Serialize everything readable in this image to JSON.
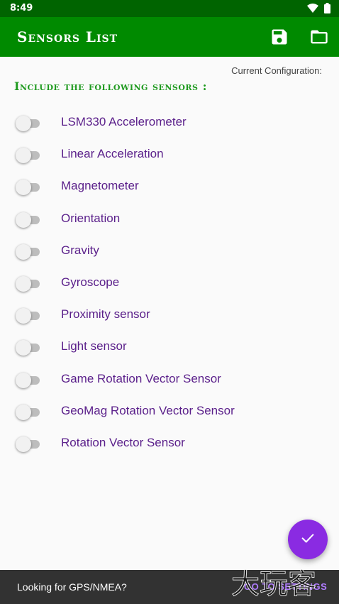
{
  "status_bar": {
    "time": "8:49",
    "icons": [
      "wifi-icon",
      "battery-icon"
    ]
  },
  "app_bar": {
    "title": "Sensors List",
    "actions": [
      "save-icon",
      "folder-icon"
    ]
  },
  "config_label": "Current Configuration:",
  "heading": "Include the following sensors :",
  "sensors": [
    {
      "label": "LSM330 Accelerometer",
      "enabled": false
    },
    {
      "label": "Linear Acceleration",
      "enabled": false
    },
    {
      "label": "Magnetometer",
      "enabled": false
    },
    {
      "label": "Orientation",
      "enabled": false
    },
    {
      "label": "Gravity",
      "enabled": false
    },
    {
      "label": "Gyroscope",
      "enabled": false
    },
    {
      "label": "Proximity sensor",
      "enabled": false
    },
    {
      "label": "Light sensor",
      "enabled": false
    },
    {
      "label": "Game Rotation Vector Sensor",
      "enabled": false
    },
    {
      "label": "GeoMag Rotation Vector Sensor",
      "enabled": false
    },
    {
      "label": "Rotation Vector Sensor",
      "enabled": false
    }
  ],
  "fab": {
    "icon": "check-icon"
  },
  "snackbar": {
    "message": "Looking for GPS/NMEA?",
    "action": "GO TO SETTINGS"
  },
  "watermark": "大玩客",
  "colors": {
    "status_bar": "#006400",
    "app_bar": "#008a00",
    "heading": "#1f9a1f",
    "label": "#5a1f8a",
    "fab": "#8a2be2",
    "snackbar": "#323232"
  }
}
